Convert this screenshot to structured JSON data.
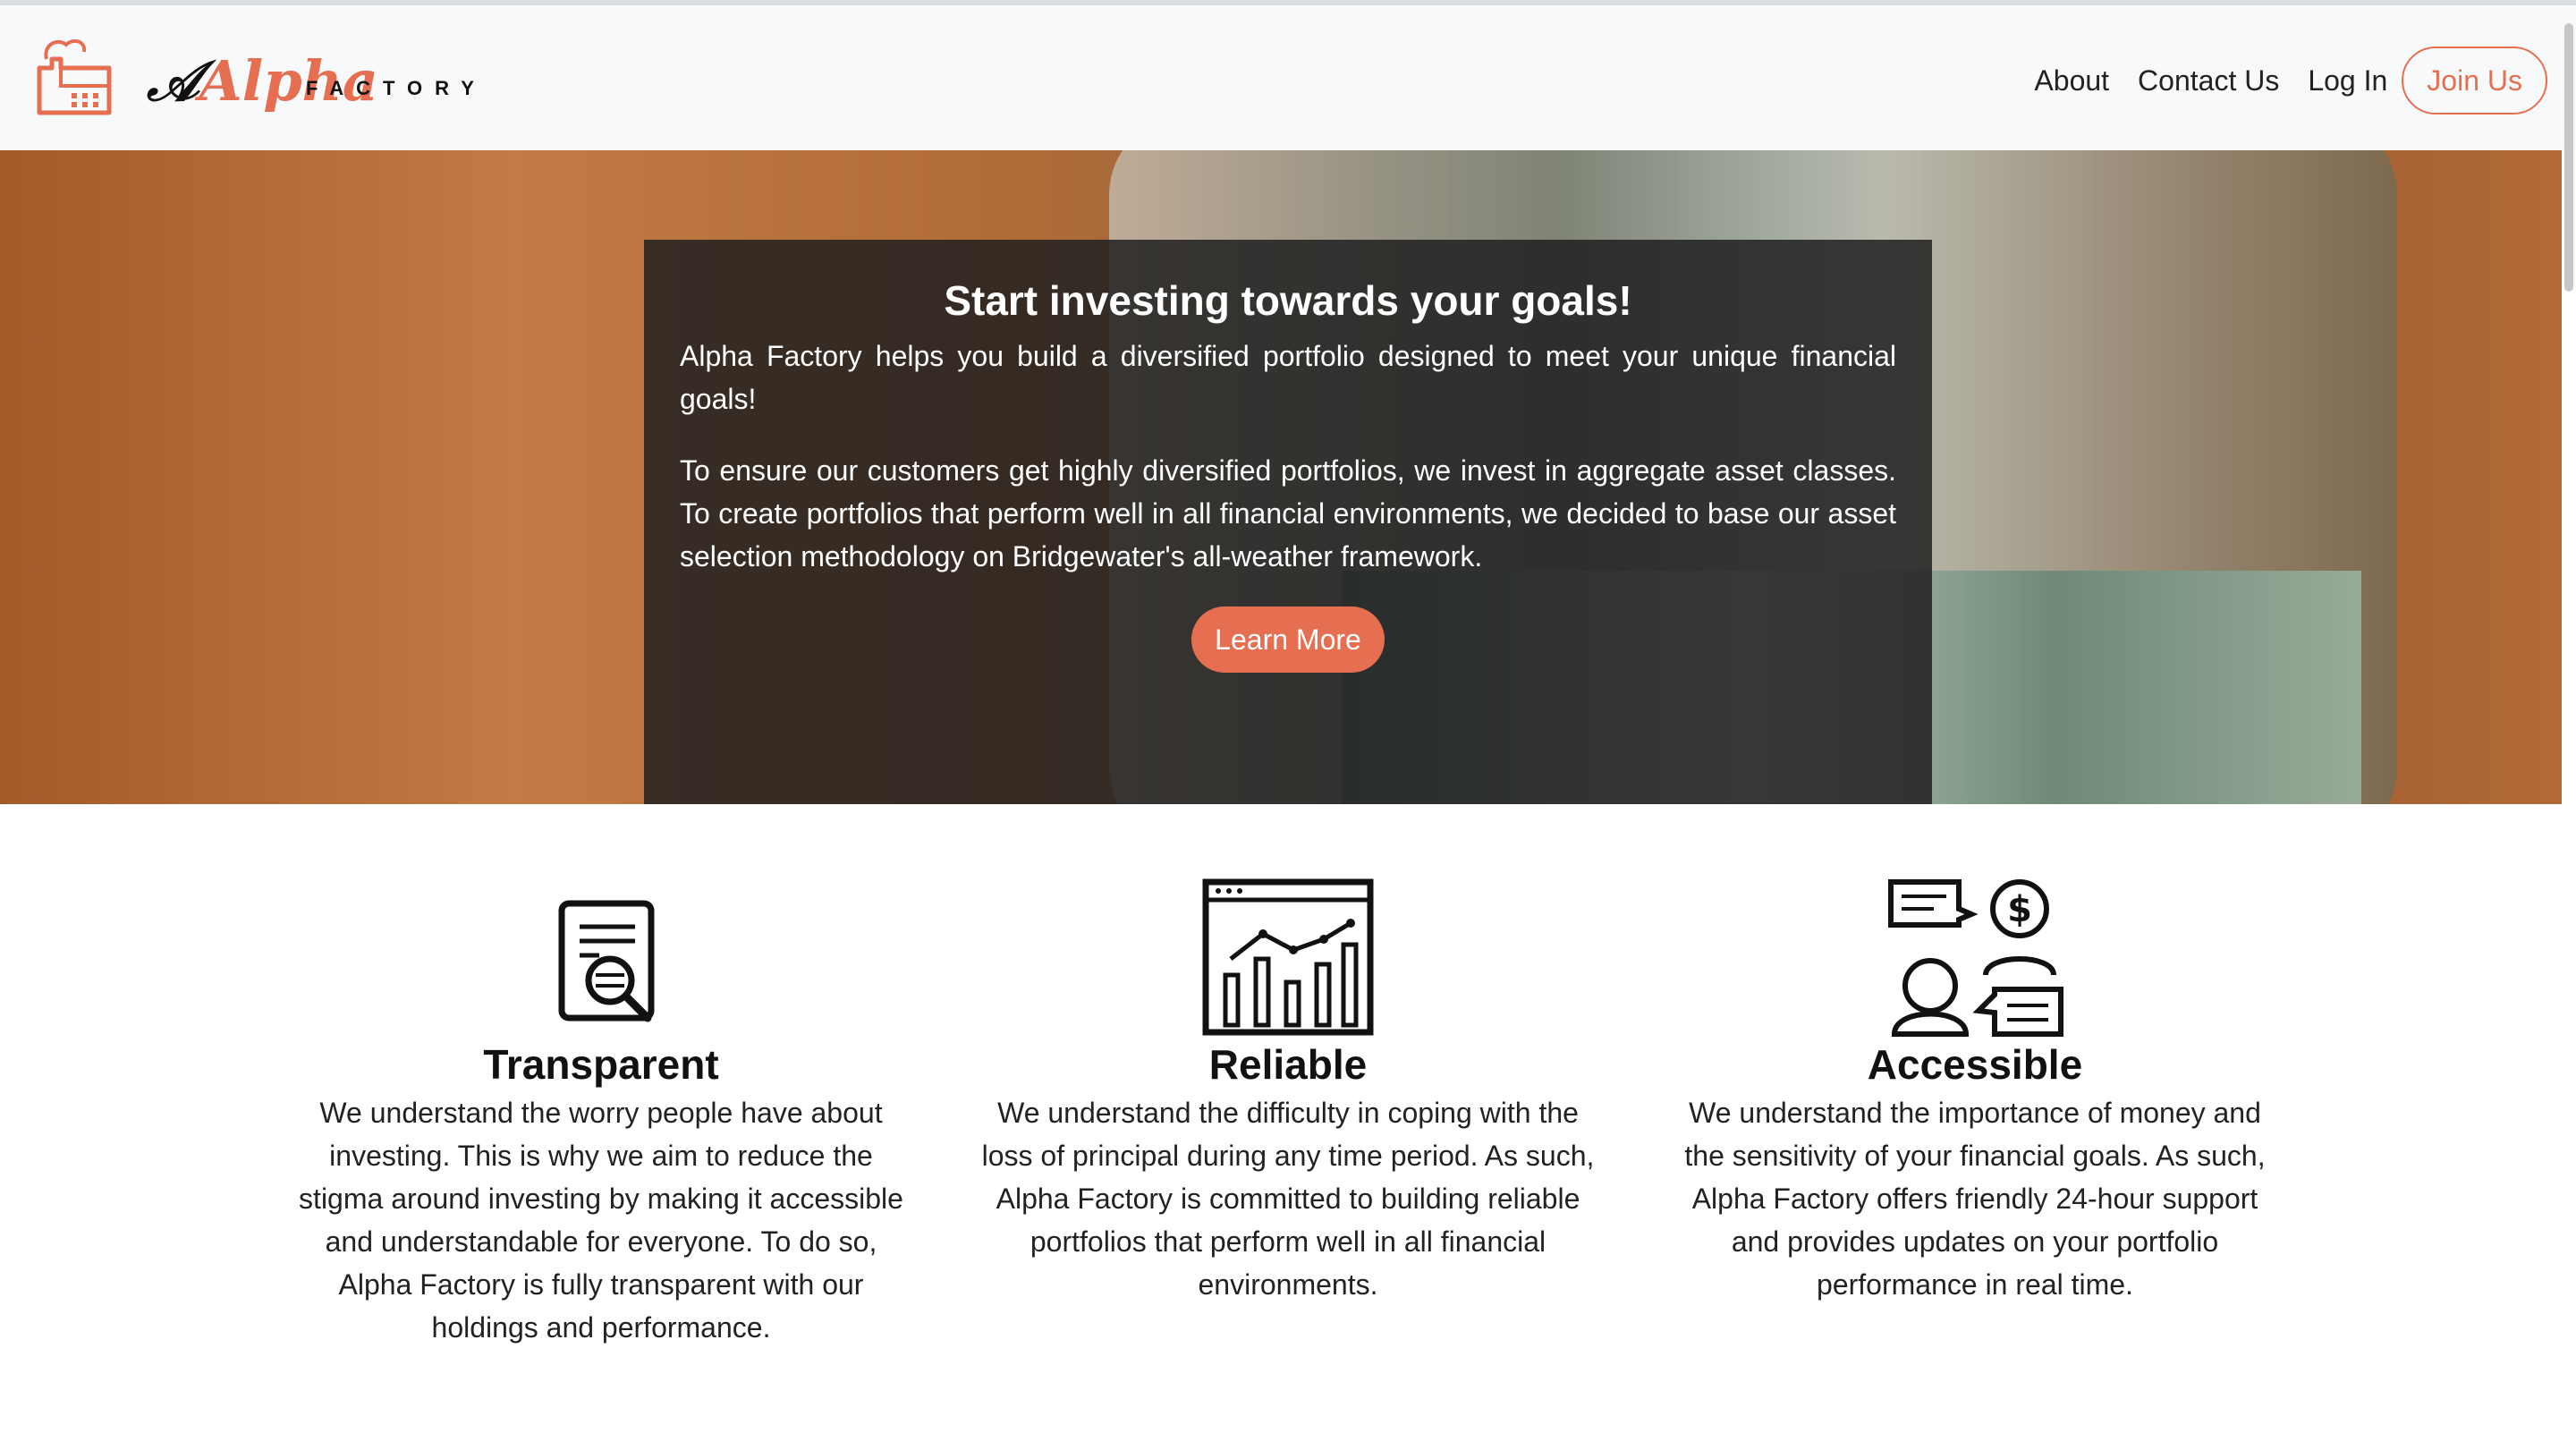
{
  "brand": {
    "script": "Alpha",
    "factory": "FACTORY",
    "accent_color": "#e76f51",
    "icon": "factory-icon"
  },
  "nav": {
    "about": "About",
    "contact": "Contact Us",
    "login": "Log In",
    "join": "Join Us"
  },
  "hero": {
    "title": "Start investing towards your goals!",
    "paragraph1": "Alpha Factory helps you build a diversified portfolio designed to meet your unique financial goals!",
    "paragraph2": "To ensure our customers get highly diversified portfolios, we invest in aggregate asset classes. To create portfolios that perform well in all financial environments, we decided to base our asset selection methodology on Bridgewater's all-weather framework.",
    "cta": "Learn More",
    "background": "money-jar-photo"
  },
  "features": [
    {
      "icon": "document-search-icon",
      "title": "Transparent",
      "text": "We understand the worry people have about investing. This is why we aim to reduce the stigma around investing by making it accessible and understandable for everyone. To do so, Alpha Factory is fully transparent with our holdings and performance."
    },
    {
      "icon": "bar-chart-icon",
      "title": "Reliable",
      "text": "We understand the difficulty in coping with the loss of principal during any time period. As such, Alpha Factory is committed to building reliable portfolios that perform well in all financial environments."
    },
    {
      "icon": "support-chat-icon",
      "title": "Accessible",
      "text": "We understand the importance of money and the sensitivity of your financial goals. As such, Alpha Factory offers friendly 24-hour support and provides updates on your portfolio performance in real time."
    }
  ]
}
